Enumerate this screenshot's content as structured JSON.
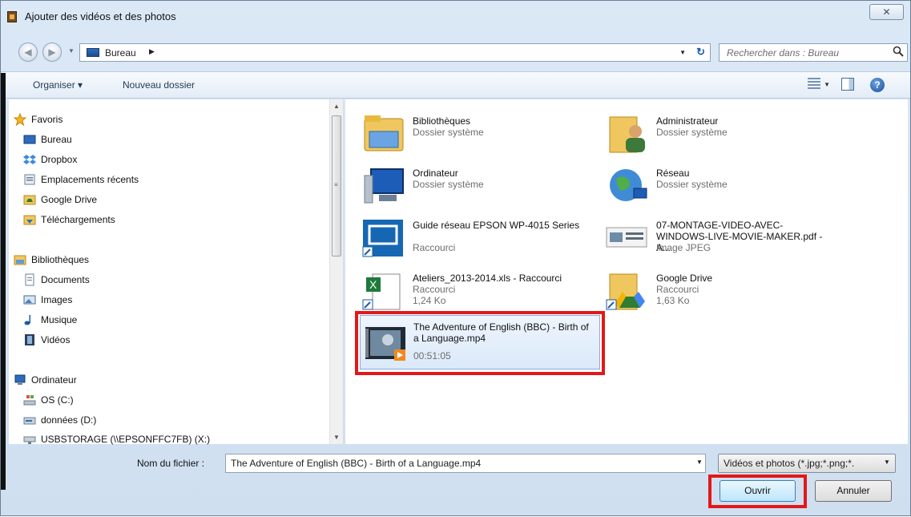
{
  "window": {
    "title": "Ajouter des vidéos et des photos",
    "close_label": "✕"
  },
  "address": {
    "crumb": "Bureau",
    "search_placeholder": "Rechercher dans : Bureau"
  },
  "toolbar": {
    "organize": "Organiser ▾",
    "new_folder": "Nouveau dossier"
  },
  "sidebar": {
    "favorites": {
      "label": "Favoris",
      "items": [
        "Bureau",
        "Dropbox",
        "Emplacements récents",
        "Google Drive",
        "Téléchargements"
      ]
    },
    "libraries": {
      "label": "Bibliothèques",
      "items": [
        "Documents",
        "Images",
        "Musique",
        "Vidéos"
      ]
    },
    "computer": {
      "label": "Ordinateur",
      "items": [
        "OS (C:)",
        "données (D:)",
        "USBSTORAGE (\\\\EPSONFFC7FB) (X:)"
      ]
    }
  },
  "files": [
    {
      "name": "Bibliothèques",
      "sub1": "Dossier système",
      "icon": "libraries-icon"
    },
    {
      "name": "Administrateur",
      "sub1": "Dossier système",
      "icon": "user-folder-icon"
    },
    {
      "name": "Ordinateur",
      "sub1": "Dossier système",
      "icon": "computer-icon"
    },
    {
      "name": "Réseau",
      "sub1": "Dossier système",
      "icon": "network-icon"
    },
    {
      "name": "Guide réseau EPSON WP-4015 Series",
      "sub1": "Raccourci",
      "icon": "epson-shortcut-icon"
    },
    {
      "name": "07-MONTAGE-VIDEO-AVEC-WINDOWS-LIVE-MOVIE-MAKER.pdf - A...",
      "sub1": "Image JPEG",
      "icon": "jpeg-thumbnail-icon"
    },
    {
      "name": "Ateliers_2013-2014.xls - Raccourci",
      "sub1": "Raccourci",
      "sub2": "1,24 Ko",
      "icon": "excel-shortcut-icon"
    },
    {
      "name": "Google Drive",
      "sub1": "Raccourci",
      "sub2": "1,63 Ko",
      "icon": "google-drive-shortcut-icon"
    },
    {
      "name": "The Adventure of English (BBC) - Birth of a Language.mp4",
      "sub1": "00:51:05",
      "icon": "video-thumbnail-icon"
    }
  ],
  "bottom": {
    "filename_label": "Nom du fichier :",
    "filename_value": "The Adventure of English (BBC) -  Birth of a Language.mp4",
    "filter_value": "Vidéos et photos (*.jpg;*.png;*.",
    "open_label": "Ouvrir",
    "cancel_label": "Annuler"
  }
}
